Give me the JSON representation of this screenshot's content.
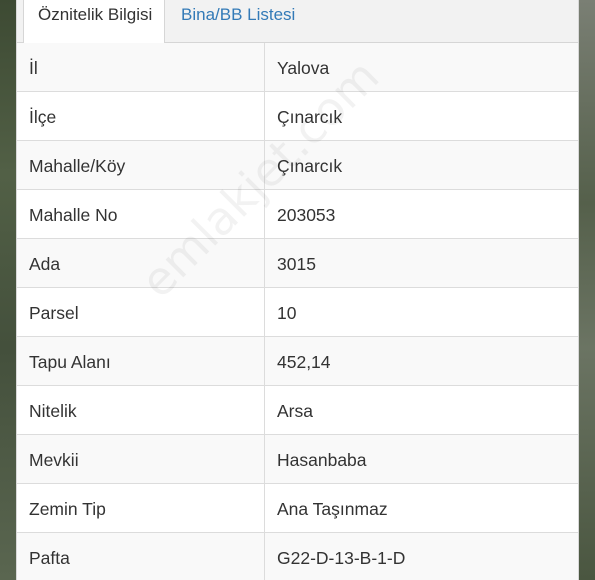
{
  "tabs": [
    {
      "label": "Öznitelik Bilgisi",
      "active": true
    },
    {
      "label": "Bina/BB Listesi",
      "active": false
    }
  ],
  "attributes": [
    {
      "label": "İl",
      "value": "Yalova"
    },
    {
      "label": "İlçe",
      "value": "Çınarcık"
    },
    {
      "label": "Mahalle/Köy",
      "value": "Çınarcık"
    },
    {
      "label": "Mahalle No",
      "value": "203053"
    },
    {
      "label": "Ada",
      "value": "3015"
    },
    {
      "label": "Parsel",
      "value": "10"
    },
    {
      "label": "Tapu Alanı",
      "value": "452,14"
    },
    {
      "label": "Nitelik",
      "value": "Arsa"
    },
    {
      "label": "Mevkii",
      "value": "Hasanbaba"
    },
    {
      "label": "Zemin Tip",
      "value": "Ana Taşınmaz"
    },
    {
      "label": "Pafta",
      "value": "G22-D-13-B-1-D"
    }
  ],
  "watermark": "emlakjet.com",
  "colors": {
    "active_tab_text": "#333333",
    "inactive_tab_link": "#337ab7",
    "stripe_row": "#f9f9f9"
  }
}
